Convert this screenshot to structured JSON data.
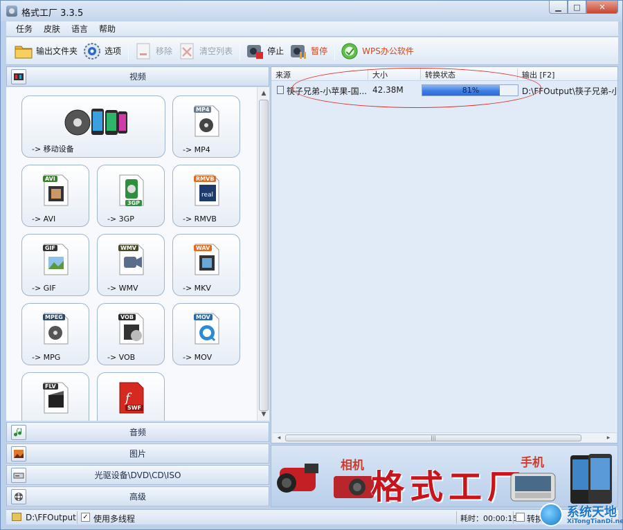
{
  "window": {
    "title": "格式工厂 3.3.5",
    "min": "▁",
    "max": "□",
    "close": "✕"
  },
  "menu": [
    "任务",
    "皮肤",
    "语言",
    "帮助"
  ],
  "toolbar": {
    "output_folder": "输出文件夹",
    "options": "选项",
    "remove": "移除",
    "clear_list": "清空列表",
    "stop": "停止",
    "pause": "暂停",
    "wps": "WPS办公软件"
  },
  "categories": {
    "video": "视频",
    "audio": "音频",
    "picture": "图片",
    "optical": "光驱设备\\DVD\\CD\\ISO",
    "advanced": "高级"
  },
  "video_tiles": {
    "mobile": "-> 移动设备",
    "mp4": "-> MP4",
    "avi": "-> AVI",
    "3gp": "-> 3GP",
    "rmvb": "-> RMVB",
    "gif": "-> GIF",
    "wmv": "-> WMV",
    "mkv": "-> MKV",
    "mpg": "-> MPG",
    "vob": "-> VOB",
    "mov": "-> MOV"
  },
  "format_tags": {
    "mp4": "MP4",
    "avi": "AVI",
    "3gp": "3GP",
    "rmvb": "RMVB",
    "gif": "GIF",
    "wmv": "WMV",
    "mkv": "WAV",
    "mpeg": "MPEG",
    "vob": "VOB",
    "mov": "MOV",
    "flv": "FLV",
    "swf": "SWF"
  },
  "task_list": {
    "columns": {
      "source": "来源",
      "size": "大小",
      "status": "转换状态",
      "output": "输出 [F2]"
    },
    "rows": [
      {
        "source": "筷子兄弟-小苹果-国...",
        "size": "42.38M",
        "progress": 0.81,
        "progress_text": "81%",
        "output": "D:\\FFOutput\\筷子兄弟-小"
      }
    ]
  },
  "banner": {
    "camera": "相机",
    "main": "格式工厂",
    "phone": "手机"
  },
  "statusbar": {
    "path": "D:\\FFOutput",
    "multithread": "使用多线程",
    "multithread_checked": "✓",
    "elapsed": "耗时：00:00:15",
    "convert": "转换"
  },
  "watermark": {
    "title": "系统天地",
    "url": "XiTongTianDi.net"
  },
  "colors": {
    "accent_red": "#c8141b",
    "progress_blue": "#3f7ee6",
    "frame": "#bcd0ea"
  }
}
